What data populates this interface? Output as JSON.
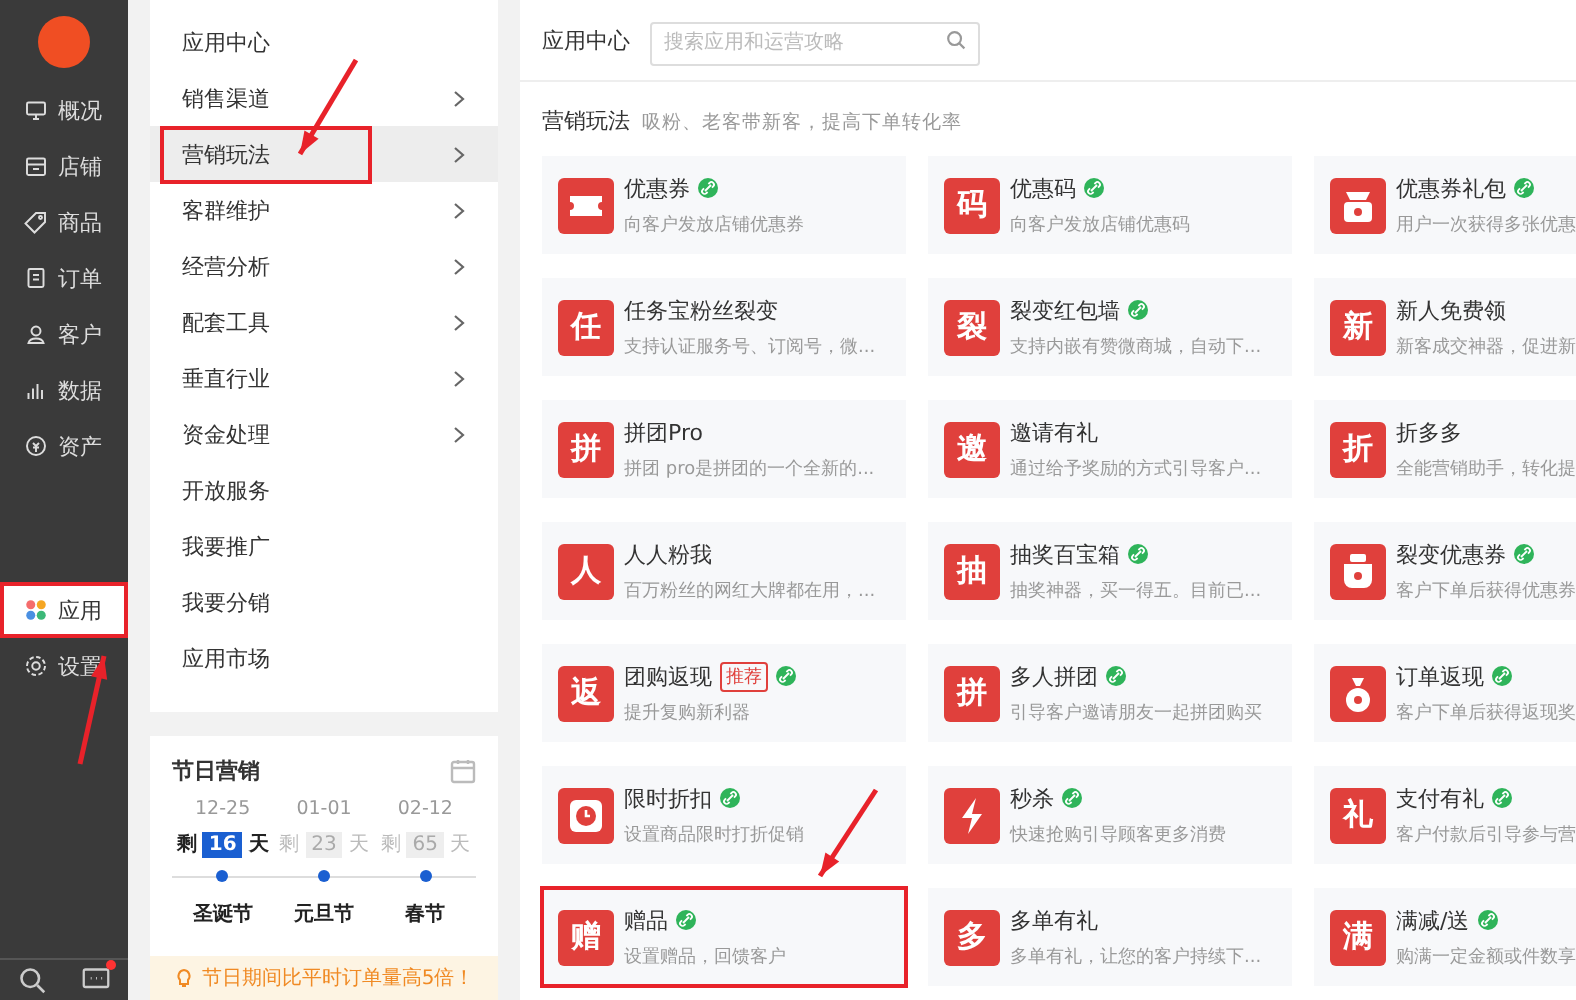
{
  "nav": {
    "items": [
      {
        "label": "概况",
        "selected": false,
        "annotated": false
      },
      {
        "label": "店铺",
        "selected": false,
        "annotated": false
      },
      {
        "label": "商品",
        "selected": false,
        "annotated": false
      },
      {
        "label": "订单",
        "selected": false,
        "annotated": false
      },
      {
        "label": "客户",
        "selected": false,
        "annotated": false
      },
      {
        "label": "数据",
        "selected": false,
        "annotated": false
      },
      {
        "label": "资产",
        "selected": false,
        "annotated": false
      }
    ],
    "lower_items": [
      {
        "label": "应用",
        "selected": true,
        "annotated": true
      },
      {
        "label": "设置",
        "selected": false,
        "annotated": false
      }
    ],
    "has_notification": true
  },
  "menu": {
    "items": [
      {
        "label": "应用中心",
        "expandable": false,
        "selected": false,
        "annotated": false
      },
      {
        "label": "销售渠道",
        "expandable": true,
        "selected": false,
        "annotated": false
      },
      {
        "label": "营销玩法",
        "expandable": true,
        "selected": true,
        "annotated": true
      },
      {
        "label": "客群维护",
        "expandable": true,
        "selected": false,
        "annotated": false
      },
      {
        "label": "经营分析",
        "expandable": true,
        "selected": false,
        "annotated": false
      },
      {
        "label": "配套工具",
        "expandable": true,
        "selected": false,
        "annotated": false
      },
      {
        "label": "垂直行业",
        "expandable": true,
        "selected": false,
        "annotated": false
      },
      {
        "label": "资金处理",
        "expandable": true,
        "selected": false,
        "annotated": false
      },
      {
        "label": "开放服务",
        "expandable": false,
        "selected": false,
        "annotated": false
      },
      {
        "label": "我要推广",
        "expandable": false,
        "selected": false,
        "annotated": false
      },
      {
        "label": "我要分销",
        "expandable": false,
        "selected": false,
        "annotated": false
      },
      {
        "label": "应用市场",
        "expandable": false,
        "selected": false,
        "annotated": false
      }
    ]
  },
  "festival": {
    "title": "节日营销",
    "days": [
      {
        "date": "12-25",
        "prefix": "剩",
        "count": "16",
        "suffix": "天",
        "name": "圣诞节",
        "selected": true
      },
      {
        "date": "01-01",
        "prefix": "剩",
        "count": "23",
        "suffix": "天",
        "name": "元旦节",
        "selected": false
      },
      {
        "date": "02-12",
        "prefix": "剩",
        "count": "65",
        "suffix": "天",
        "name": "春节",
        "selected": false
      }
    ],
    "tip": "节日期间比平时订单量高5倍！"
  },
  "header": {
    "title": "应用中心",
    "search": {
      "placeholder": "搜索应用和运营攻略"
    }
  },
  "section": {
    "title": "营销玩法",
    "subtitle": "吸粉、老客带新客，提高下单转化率"
  },
  "apps": [
    {
      "kind": "drawing",
      "name": "优惠券",
      "linked": true,
      "desc": "向客户发放店铺优惠券",
      "annotated": false
    },
    {
      "kind": "char",
      "glyph": "码",
      "name": "优惠码",
      "linked": true,
      "desc": "向客户发放店铺优惠码",
      "annotated": false
    },
    {
      "kind": "drawing",
      "name": "优惠券礼包",
      "linked": true,
      "desc": "用户一次获得多张优惠",
      "annotated": false
    },
    {
      "kind": "char",
      "glyph": "任",
      "name": "任务宝粉丝裂变",
      "linked": false,
      "desc": "支持认证服务号、订阅号，微...",
      "annotated": false
    },
    {
      "kind": "char",
      "glyph": "裂",
      "name": "裂变红包墙",
      "linked": true,
      "desc": "支持内嵌有赞微商城，自动下...",
      "annotated": false
    },
    {
      "kind": "char",
      "glyph": "新",
      "name": "新人免费领",
      "linked": false,
      "desc": "新客成交神器，促进新",
      "annotated": false
    },
    {
      "kind": "char",
      "glyph": "拼",
      "name": "拼团Pro",
      "linked": false,
      "desc": "拼团 pro是拼团的一个全新的...",
      "annotated": false
    },
    {
      "kind": "char",
      "glyph": "邀",
      "name": "邀请有礼",
      "linked": false,
      "desc": "通过给予奖励的方式引导客户...",
      "annotated": false
    },
    {
      "kind": "char",
      "glyph": "折",
      "name": "折多多",
      "linked": false,
      "desc": "全能营销助手，转化提",
      "annotated": false
    },
    {
      "kind": "char",
      "glyph": "人",
      "name": "人人粉我",
      "linked": false,
      "desc": "百万粉丝的网红大牌都在用，...",
      "annotated": false
    },
    {
      "kind": "char",
      "glyph": "抽",
      "name": "抽奖百宝箱",
      "linked": true,
      "desc": "抽奖神器，买一得五。目前已...",
      "annotated": false
    },
    {
      "kind": "drawing",
      "name": "裂变优惠券",
      "linked": true,
      "desc": "客户下单后获得优惠券",
      "annotated": false
    },
    {
      "kind": "char",
      "glyph": "返",
      "name": "团购返现",
      "tag": "推荐",
      "linked": true,
      "desc": "提升复购新利器",
      "annotated": false
    },
    {
      "kind": "char",
      "glyph": "拼",
      "name": "多人拼团",
      "linked": true,
      "desc": "引导客户邀请朋友一起拼团购买",
      "annotated": false
    },
    {
      "kind": "drawing",
      "name": "订单返现",
      "linked": true,
      "desc": "客户下单后获得返现奖",
      "annotated": false
    },
    {
      "kind": "drawing",
      "name": "限时折扣",
      "linked": true,
      "desc": "设置商品限时打折促销",
      "annotated": false
    },
    {
      "kind": "drawing",
      "name": "秒杀",
      "linked": true,
      "desc": "快速抢购引导顾客更多消费",
      "annotated": false
    },
    {
      "kind": "char",
      "glyph": "礼",
      "name": "支付有礼",
      "linked": true,
      "desc": "客户付款后引导参与营",
      "annotated": false
    },
    {
      "kind": "char",
      "glyph": "赠",
      "name": "赠品",
      "linked": true,
      "desc": "设置赠品，回馈客户",
      "annotated": true
    },
    {
      "kind": "char",
      "glyph": "多",
      "name": "多单有礼",
      "linked": false,
      "desc": "多单有礼，让您的客户持续下...",
      "annotated": false
    },
    {
      "kind": "char",
      "glyph": "满",
      "name": "满减/送",
      "linked": true,
      "desc": "购满一定金额或件数享",
      "annotated": false
    }
  ]
}
